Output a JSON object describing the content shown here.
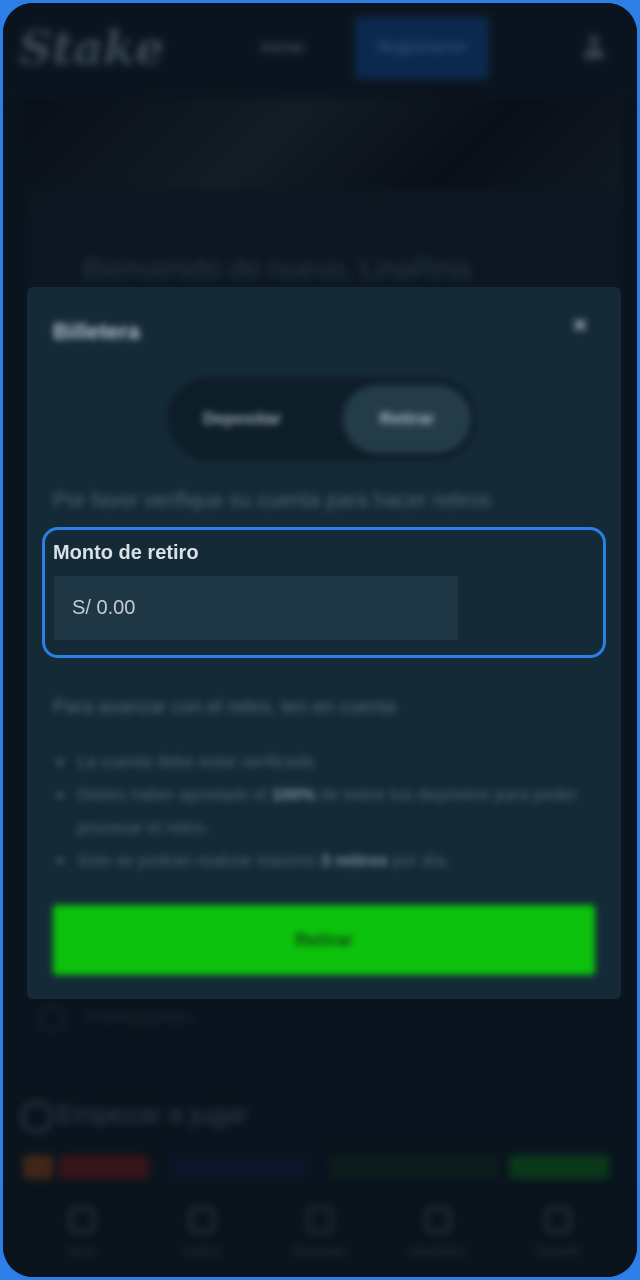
{
  "header": {
    "logo": "Stake",
    "login_label": "Iniciar",
    "register_label": "Registrarse"
  },
  "welcome": {
    "text": "Bienvenido de nuevo, LinaRina"
  },
  "wallet": {
    "title": "Billetera",
    "tabs": {
      "deposit": "Depositar",
      "withdraw": "Retirar"
    },
    "verify_notice": "Por favor verifique su cuenta para hacer retiros",
    "amount_label": "Monto de retiro",
    "amount_placeholder": "S/ 0.00",
    "notes_intro": "Para avanzar con el retiro, ten en cuenta",
    "notes": [
      {
        "pre": "La cuenta debe estar verificada",
        "bold": "",
        "post": ""
      },
      {
        "pre": "Debes haber apostado el ",
        "bold": "100%",
        "post": " de todos tus depósitos para poder procesar el retiro."
      },
      {
        "pre": "Solo se podrán realizar máximo ",
        "bold": "3 retiros",
        "post": " por día."
      }
    ],
    "submit_label": "Retirar",
    "colors": {
      "submit": "#0cc20c",
      "focus_ring": "#2b7fe6"
    }
  },
  "promo": {
    "text": "Promociones"
  },
  "start": {
    "title": "Empezar a jugar"
  },
  "bottom_nav": [
    {
      "label": "Inicio",
      "icon": "home-icon"
    },
    {
      "label": "Casino",
      "icon": "casino-icon"
    },
    {
      "label": "Apuestas",
      "icon": "sports-icon"
    },
    {
      "label": "Depósitos",
      "icon": "wallet-icon"
    },
    {
      "label": "Soporte",
      "icon": "support-icon"
    }
  ]
}
